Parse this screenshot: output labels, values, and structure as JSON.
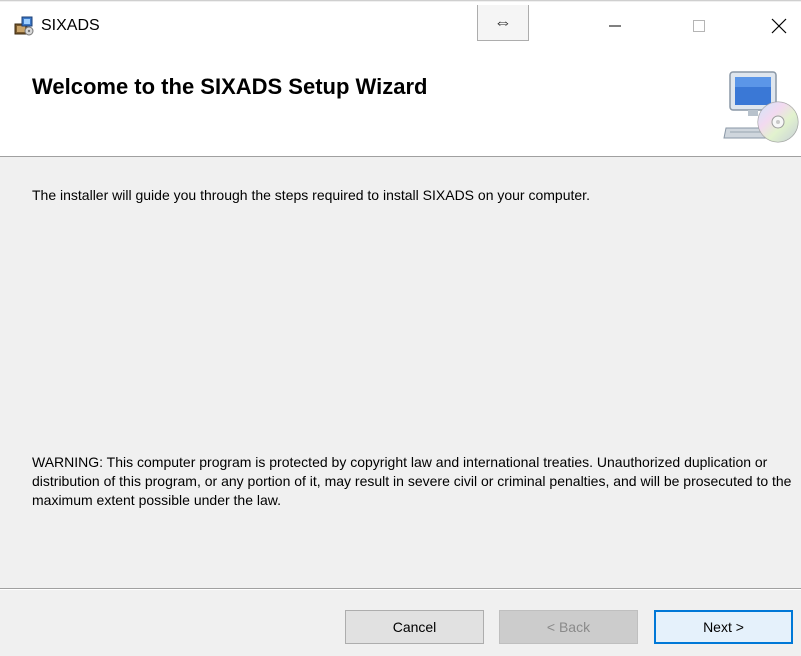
{
  "window": {
    "title": "SIXADS",
    "resize_glyph": "⇔",
    "controls": {
      "minimize_icon": "minimize-icon",
      "maximize_icon": "maximize-icon",
      "close_icon": "close-icon"
    }
  },
  "banner": {
    "title": "Welcome to the SIXADS Setup Wizard",
    "image_icon": "computer-cd-icon"
  },
  "content": {
    "intro": "The installer will guide you through the steps required to install SIXADS on your computer.",
    "warning": "WARNING: This computer program is protected by copyright law and international treaties. Unauthorized duplication or distribution of this program, or any portion of it, may result in severe civil or criminal penalties, and will be prosecuted to the maximum extent possible under the law."
  },
  "buttons": {
    "cancel": "Cancel",
    "back": "< Back",
    "next": "Next >"
  },
  "colors": {
    "accent": "#0078d7",
    "background": "#f0f0f0"
  }
}
